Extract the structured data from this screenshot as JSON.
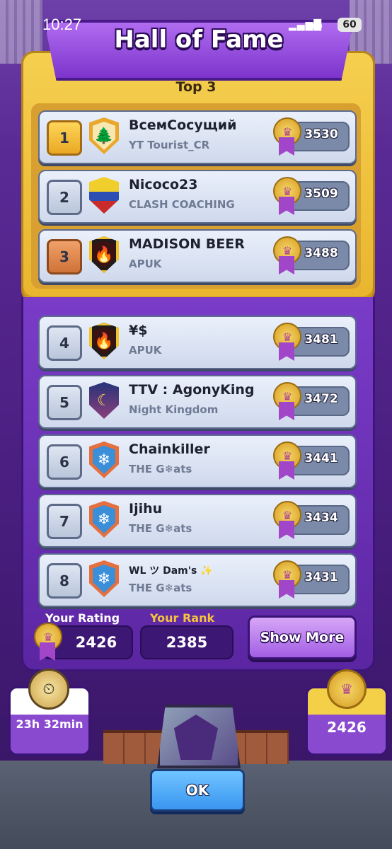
{
  "status_bar": {
    "time": "10:27",
    "battery": "60"
  },
  "title": "Hall of Fame",
  "top3_label": "Top 3",
  "players": [
    {
      "rank": "1",
      "name": "ВсемСосущий",
      "clan": "YT Tourist_CR",
      "score": "3530",
      "badge": "tree-badge-icon"
    },
    {
      "rank": "2",
      "name": "Nicoco23",
      "clan": "CLASH COACHING",
      "score": "3509",
      "badge": "flag-badge-icon"
    },
    {
      "rank": "3",
      "name": "MADISON BEER",
      "clan": "APUK",
      "score": "3488",
      "badge": "fire-badge-icon"
    },
    {
      "rank": "4",
      "name": "¥$",
      "clan": "APUK",
      "score": "3481",
      "badge": "fire-badge-icon"
    },
    {
      "rank": "5",
      "name": "TTV : AgonyKing",
      "clan": "Night Kingdom",
      "score": "3472",
      "badge": "moon-badge-icon"
    },
    {
      "rank": "6",
      "name": "Chainkiller",
      "clan": "THE G❄ats",
      "score": "3441",
      "badge": "snowflake-badge-icon"
    },
    {
      "rank": "7",
      "name": "Ijihu",
      "clan": "THE G❄ats",
      "score": "3434",
      "badge": "snowflake-badge-icon"
    },
    {
      "rank": "8",
      "name": "WL ツ Dam's ✨",
      "clan": "THE G❄ats",
      "score": "3431",
      "badge": "snowflake-badge-icon"
    }
  ],
  "your_rating": {
    "label": "Your Rating",
    "value": "2426"
  },
  "your_rank": {
    "label": "Your Rank",
    "value": "2385"
  },
  "show_more": "Show More",
  "season_timer": "23h 32min",
  "trophies": "2426",
  "ok_button": "OK",
  "colors": {
    "gold": "#f5cf4f",
    "purple": "#7a3cc8",
    "button_blue": "#3a96f0"
  }
}
